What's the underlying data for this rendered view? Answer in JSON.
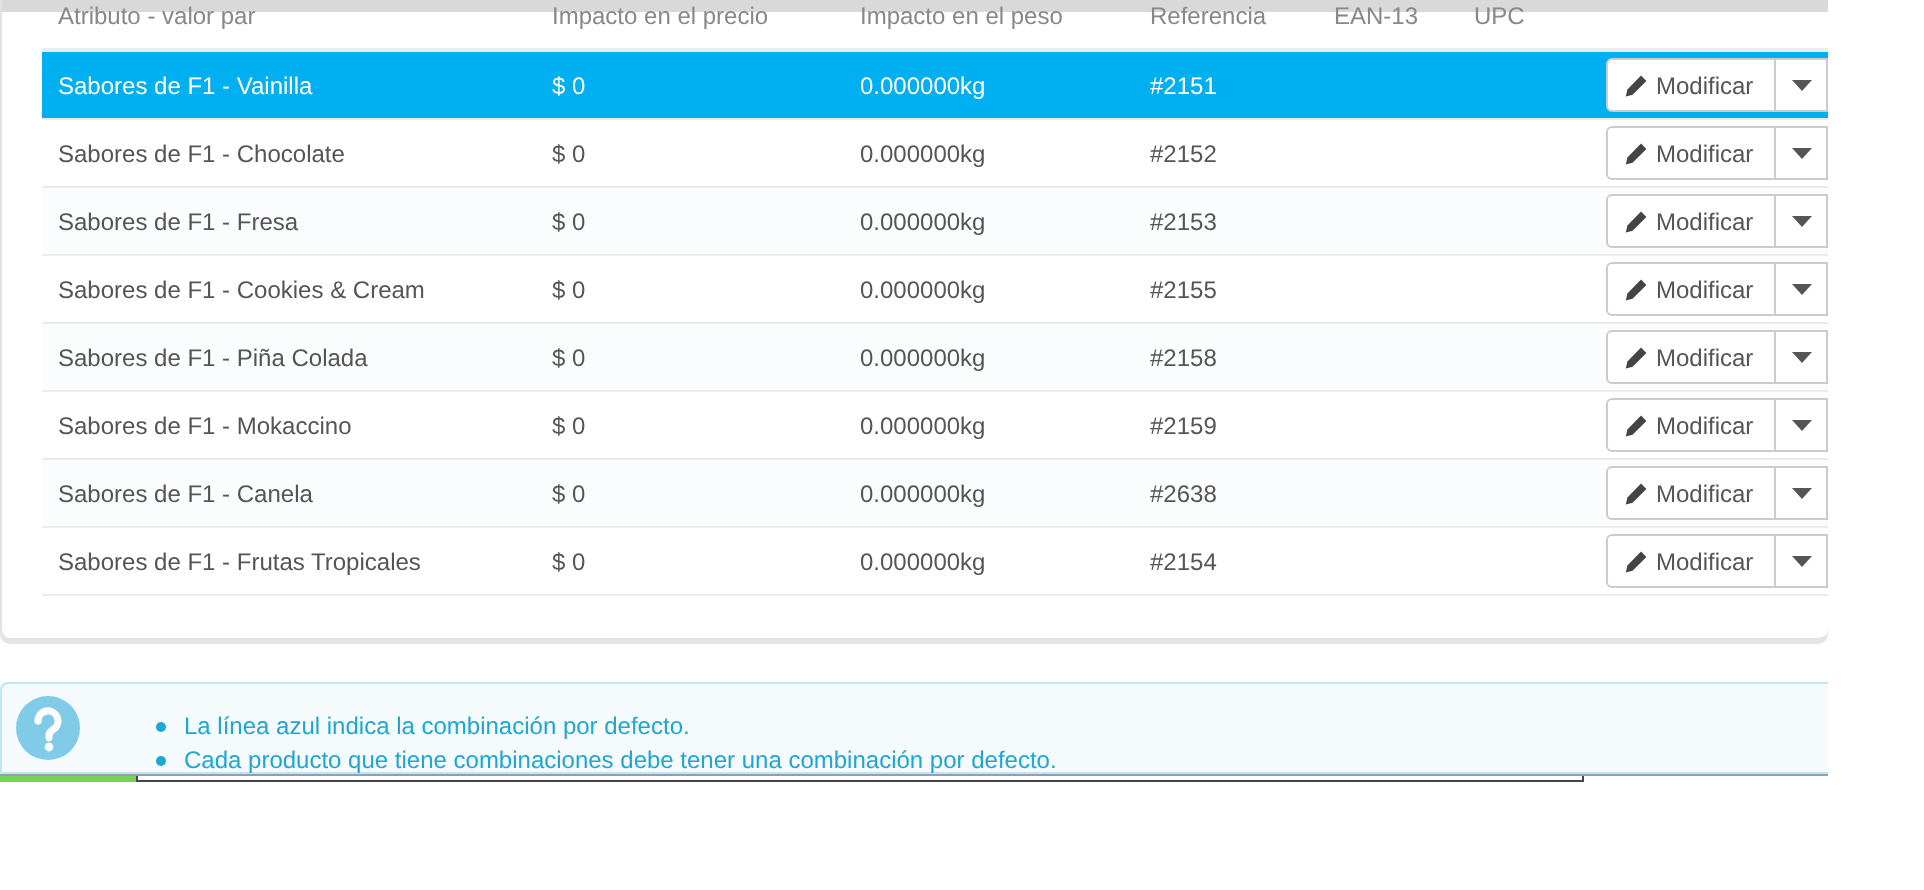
{
  "table": {
    "columns": [
      "Atributo - valor par",
      "Impacto en el precio",
      "Impacto en el peso",
      "Referencia",
      "EAN-13",
      "UPC"
    ],
    "rows": [
      {
        "selected": true,
        "attribute": "Sabores de F1 - Vainilla",
        "price": "$ 0",
        "weight": "0.000000kg",
        "reference": "#2151",
        "action": "Modificar"
      },
      {
        "selected": false,
        "attribute": "Sabores de F1 - Chocolate",
        "price": "$ 0",
        "weight": "0.000000kg",
        "reference": "#2152",
        "action": "Modificar"
      },
      {
        "selected": false,
        "attribute": "Sabores de F1 - Fresa",
        "price": "$ 0",
        "weight": "0.000000kg",
        "reference": "#2153",
        "action": "Modificar"
      },
      {
        "selected": false,
        "attribute": "Sabores de F1 - Cookies & Cream",
        "price": "$ 0",
        "weight": "0.000000kg",
        "reference": "#2155",
        "action": "Modificar"
      },
      {
        "selected": false,
        "attribute": "Sabores de F1 - Piña Colada",
        "price": "$ 0",
        "weight": "0.000000kg",
        "reference": "#2158",
        "action": "Modificar"
      },
      {
        "selected": false,
        "attribute": "Sabores de F1 - Mokaccino",
        "price": "$ 0",
        "weight": "0.000000kg",
        "reference": "#2159",
        "action": "Modificar"
      },
      {
        "selected": false,
        "attribute": "Sabores de F1 - Canela",
        "price": "$ 0",
        "weight": "0.000000kg",
        "reference": "#2638",
        "action": "Modificar"
      },
      {
        "selected": false,
        "attribute": "Sabores de F1 - Frutas Tropicales",
        "price": "$ 0",
        "weight": "0.000000kg",
        "reference": "#2154",
        "action": "Modificar"
      }
    ]
  },
  "help": {
    "items": [
      "La línea azul indica la combinación por defecto.",
      "Cada producto que tiene combinaciones debe tener una combinación por defecto."
    ]
  }
}
